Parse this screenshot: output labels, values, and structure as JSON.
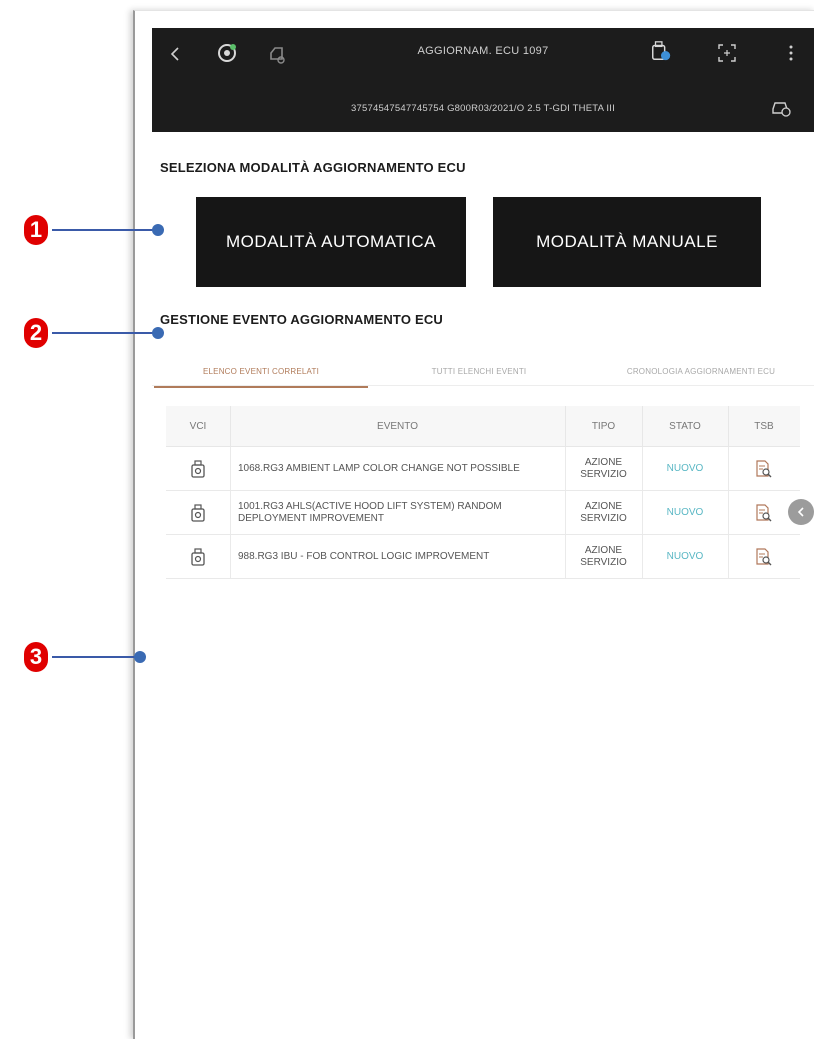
{
  "topbar": {
    "title": "AGGIORNAM. ECU 1097",
    "subtitle": "37574547547745754  G800R03/2021/O 2.5 T-GDI THETA III"
  },
  "mode_section": {
    "title": "SELEZIONA MODALITÀ AGGIORNAMENTO ECU",
    "auto_button": "MODALITÀ AUTOMATICA",
    "manual_button": "MODALITÀ MANUALE"
  },
  "event_section": {
    "title": "GESTIONE EVENTO AGGIORNAMENTO ECU",
    "tabs": [
      {
        "label": "ELENCO EVENTI CORRELATI",
        "active": true
      },
      {
        "label": "TUTTI ELENCHI EVENTI",
        "active": false
      },
      {
        "label": "CRONOLOGIA AGGIORNAMENTI ECU",
        "active": false
      }
    ]
  },
  "table": {
    "headers": [
      "VCI",
      "EVENTO",
      "TIPO",
      "STATO",
      "TSB"
    ],
    "rows": [
      {
        "evento": "1068.RG3 AMBIENT LAMP COLOR CHANGE NOT POSSIBLE",
        "tipo": "AZIONE SERVIZIO",
        "stato": "NUOVO"
      },
      {
        "evento": "1001.RG3 AHLS(ACTIVE HOOD LIFT SYSTEM) RANDOM DEPLOYMENT IMPROVEMENT",
        "tipo": "AZIONE SERVIZIO",
        "stato": "NUOVO"
      },
      {
        "evento": "988.RG3 IBU - FOB CONTROL LOGIC IMPROVEMENT",
        "tipo": "AZIONE SERVIZIO",
        "stato": "NUOVO"
      }
    ]
  },
  "callouts": [
    "1",
    "2",
    "3"
  ],
  "colors": {
    "callout": "#e00000",
    "callout_line": "#3a5aa8",
    "tab_active": "#b07b5a",
    "status_new": "#59b7c4",
    "topbar_bg": "#1c1c1c"
  },
  "icons": [
    "back-icon",
    "vci-connection-icon",
    "vehicle-icon",
    "vci-device-icon",
    "screen-capture-icon",
    "more-vert-icon",
    "car-settings-icon",
    "vci-row-icon",
    "tsb-document-icon"
  ]
}
